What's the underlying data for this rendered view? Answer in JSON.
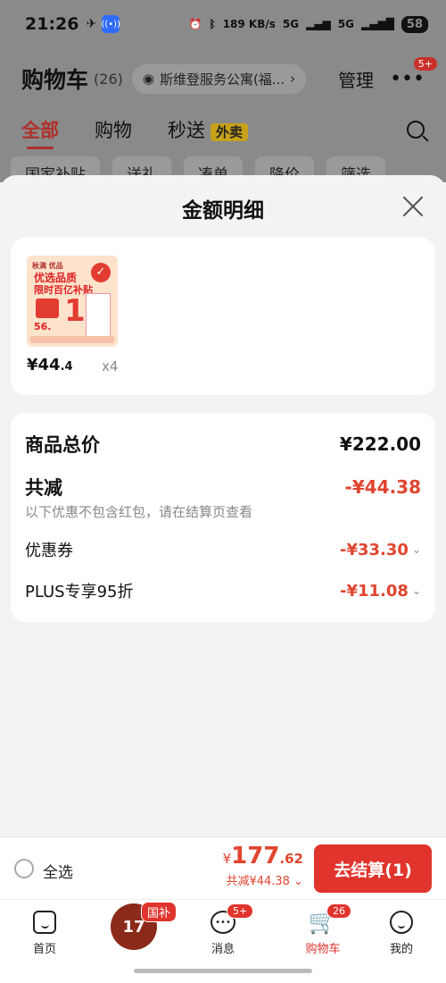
{
  "status_bar": {
    "time": "21:26",
    "speed": "189 KB/s",
    "network1": "5G",
    "network2": "5G",
    "battery": "58"
  },
  "header": {
    "title": "购物车",
    "count": "(26)",
    "address": "斯维登服务公寓(福...",
    "manage_label": "管理",
    "more_badge": "5+"
  },
  "tabs": [
    {
      "label": "全部"
    },
    {
      "label": "购物"
    },
    {
      "label": "秒送"
    }
  ],
  "waimai_tag": "外卖",
  "filter_chips": [
    "国家补贴",
    "送礼",
    "凑单",
    "降价",
    "筛选"
  ],
  "sheet": {
    "title": "金额明细",
    "item": {
      "thumb_brand": "秋满 优品",
      "thumb_line1": "优选品质",
      "thumb_line2": "限时百亿补贴",
      "thumb_num": "1",
      "thumb_price": "56.",
      "price_main": "¥44",
      "price_decimal": ".4",
      "quantity": "x4"
    },
    "summary": {
      "total_label": "商品总价",
      "total_value": "¥222.00",
      "reduce_label": "共减",
      "reduce_value": "-¥44.38",
      "note": "以下优惠不包含红包，请在结算页查看",
      "coupon_label": "优惠券",
      "coupon_value": "-¥33.30",
      "plus_label": "PLUS专享95折",
      "plus_value": "-¥11.08"
    }
  },
  "checkout": {
    "select_all": "全选",
    "yen": "¥",
    "amount_int": "177",
    "amount_dec": ".62",
    "reduced": "共减¥44.38",
    "pay_label": "去结算(1)"
  },
  "tabbar": {
    "home": "首页",
    "promo_tag": "国补",
    "messages": "消息",
    "messages_badge": "5+",
    "cart": "购物车",
    "cart_badge": "26",
    "me": "我的"
  },
  "colors": {
    "accent": "#e0342c",
    "discount": "#e0452f"
  }
}
